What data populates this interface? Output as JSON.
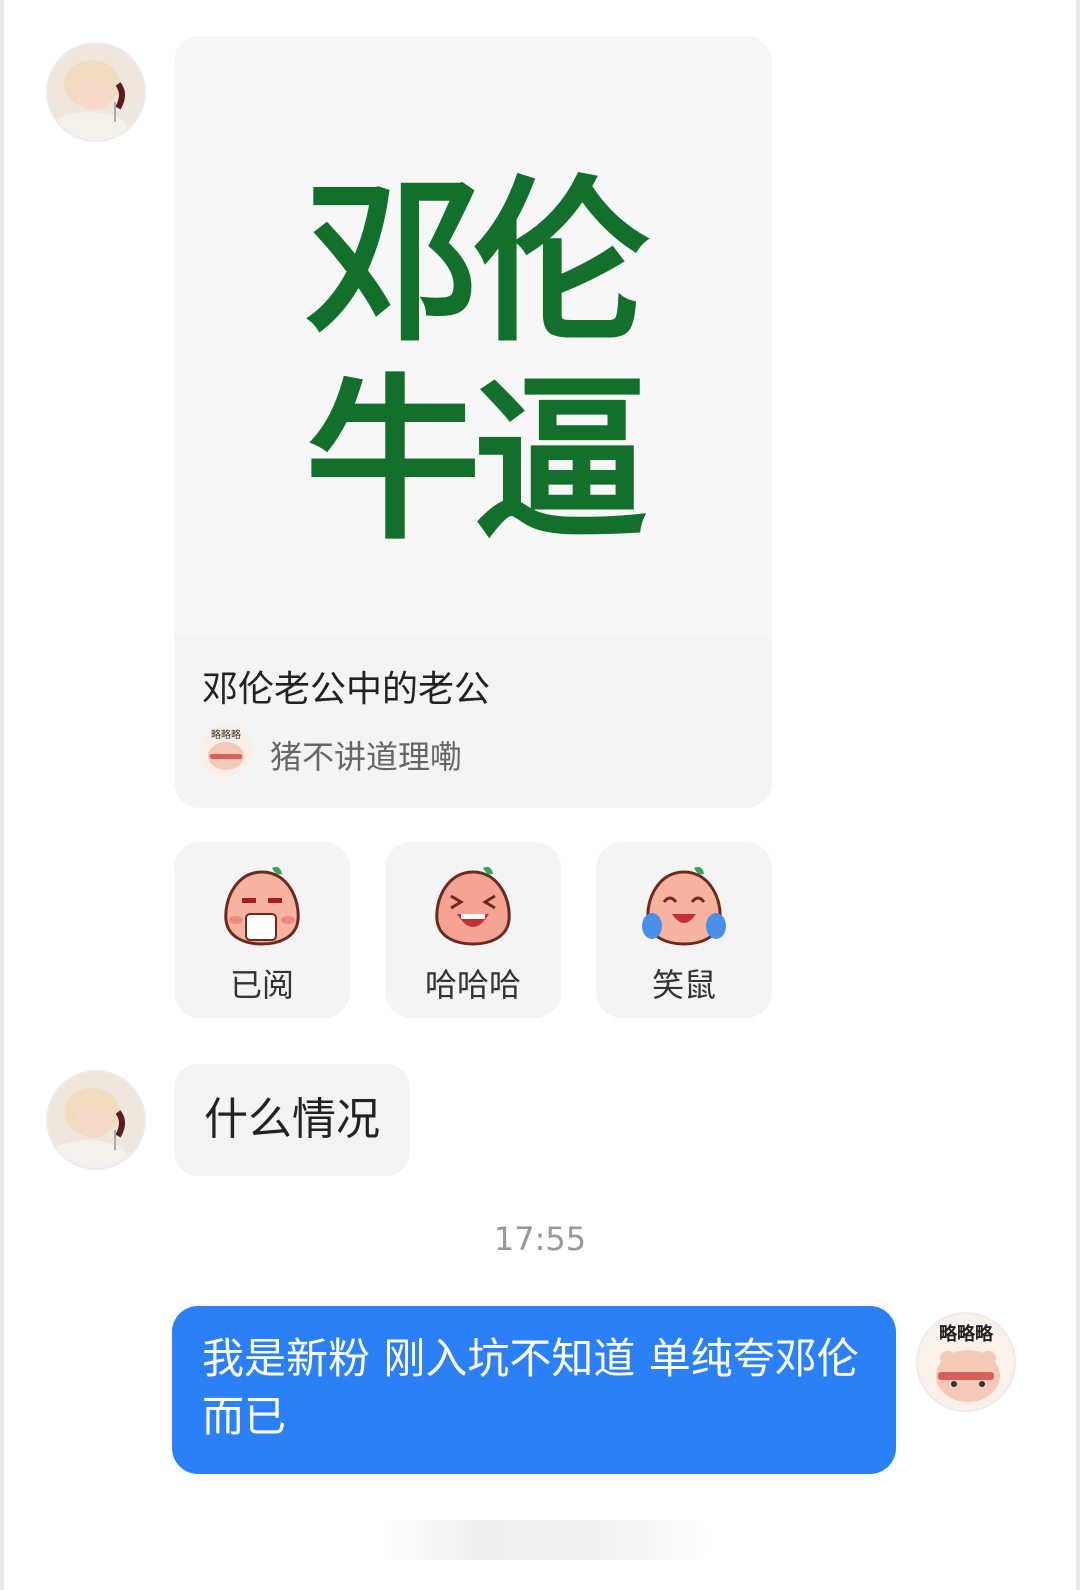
{
  "messages": {
    "card": {
      "image_line1": "邓伦",
      "image_line2": "牛逼",
      "title": "邓伦老公中的老公",
      "author": "猪不讲道理嘞"
    },
    "reactions": [
      {
        "label": "已阅",
        "icon": "sipping-tea-icon"
      },
      {
        "label": "哈哈哈",
        "icon": "laughing-icon"
      },
      {
        "label": "笑鼠",
        "icon": "laugh-crying-icon"
      }
    ],
    "left_text": "什么情况",
    "timestamp": "17:55",
    "right_text": "我是新粉 刚入坑不知道 单纯夸邓伦而已"
  },
  "colors": {
    "accent_blue": "#2b7ff7",
    "image_green": "#136f2c",
    "bubble_gray": "#f3f3f3"
  }
}
